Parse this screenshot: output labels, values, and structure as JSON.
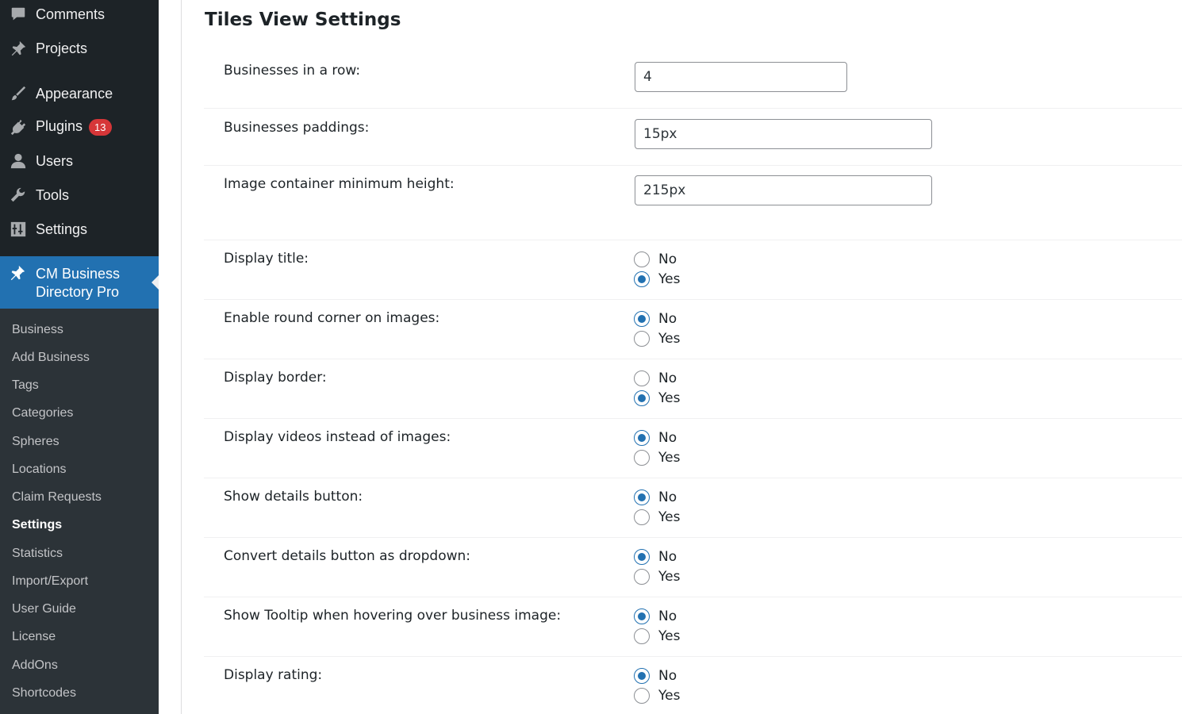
{
  "sidebar": {
    "menu": [
      {
        "label": "Comments",
        "icon": "comments-icon"
      },
      {
        "label": "Projects",
        "icon": "pin-icon"
      },
      {
        "label": "Appearance",
        "icon": "brush-icon"
      },
      {
        "label": "Plugins",
        "icon": "plugin-icon",
        "badge": "13"
      },
      {
        "label": "Users",
        "icon": "user-icon"
      },
      {
        "label": "Tools",
        "icon": "wrench-icon"
      },
      {
        "label": "Settings",
        "icon": "sliders-icon"
      }
    ],
    "current": {
      "line1": "CM Business",
      "line2": "Directory Pro",
      "icon": "pin-icon"
    },
    "submenu": [
      "Business",
      "Add Business",
      "Tags",
      "Categories",
      "Spheres",
      "Locations",
      "Claim Requests",
      "Settings",
      "Statistics",
      "Import/Export",
      "User Guide",
      "License",
      "AddOns",
      "Shortcodes"
    ],
    "submenu_current": "Settings"
  },
  "page": {
    "title": "Tiles View Settings",
    "fields": {
      "businesses_in_row": {
        "label": "Businesses in a row:",
        "value": "4"
      },
      "paddings": {
        "label": "Businesses paddings:",
        "value": "15px"
      },
      "image_min_height": {
        "label": "Image container minimum height:",
        "value": "215px"
      }
    },
    "radio_options": {
      "no": "No",
      "yes": "Yes"
    },
    "radios": [
      {
        "label": "Display title:",
        "selected": "yes"
      },
      {
        "label": "Enable round corner on images:",
        "selected": "no"
      },
      {
        "label": "Display border:",
        "selected": "yes"
      },
      {
        "label": "Display videos instead of images:",
        "selected": "no"
      },
      {
        "label": "Show details button:",
        "selected": "no"
      },
      {
        "label": "Convert details button as dropdown:",
        "selected": "no"
      },
      {
        "label": "Show Tooltip when hovering over business image:",
        "selected": "no"
      },
      {
        "label": "Display rating:",
        "selected": "no"
      }
    ]
  },
  "colors": {
    "sidebar_bg": "#1d2327",
    "submenu_bg": "#2c3338",
    "accent": "#2271b1",
    "badge": "#d63638"
  }
}
